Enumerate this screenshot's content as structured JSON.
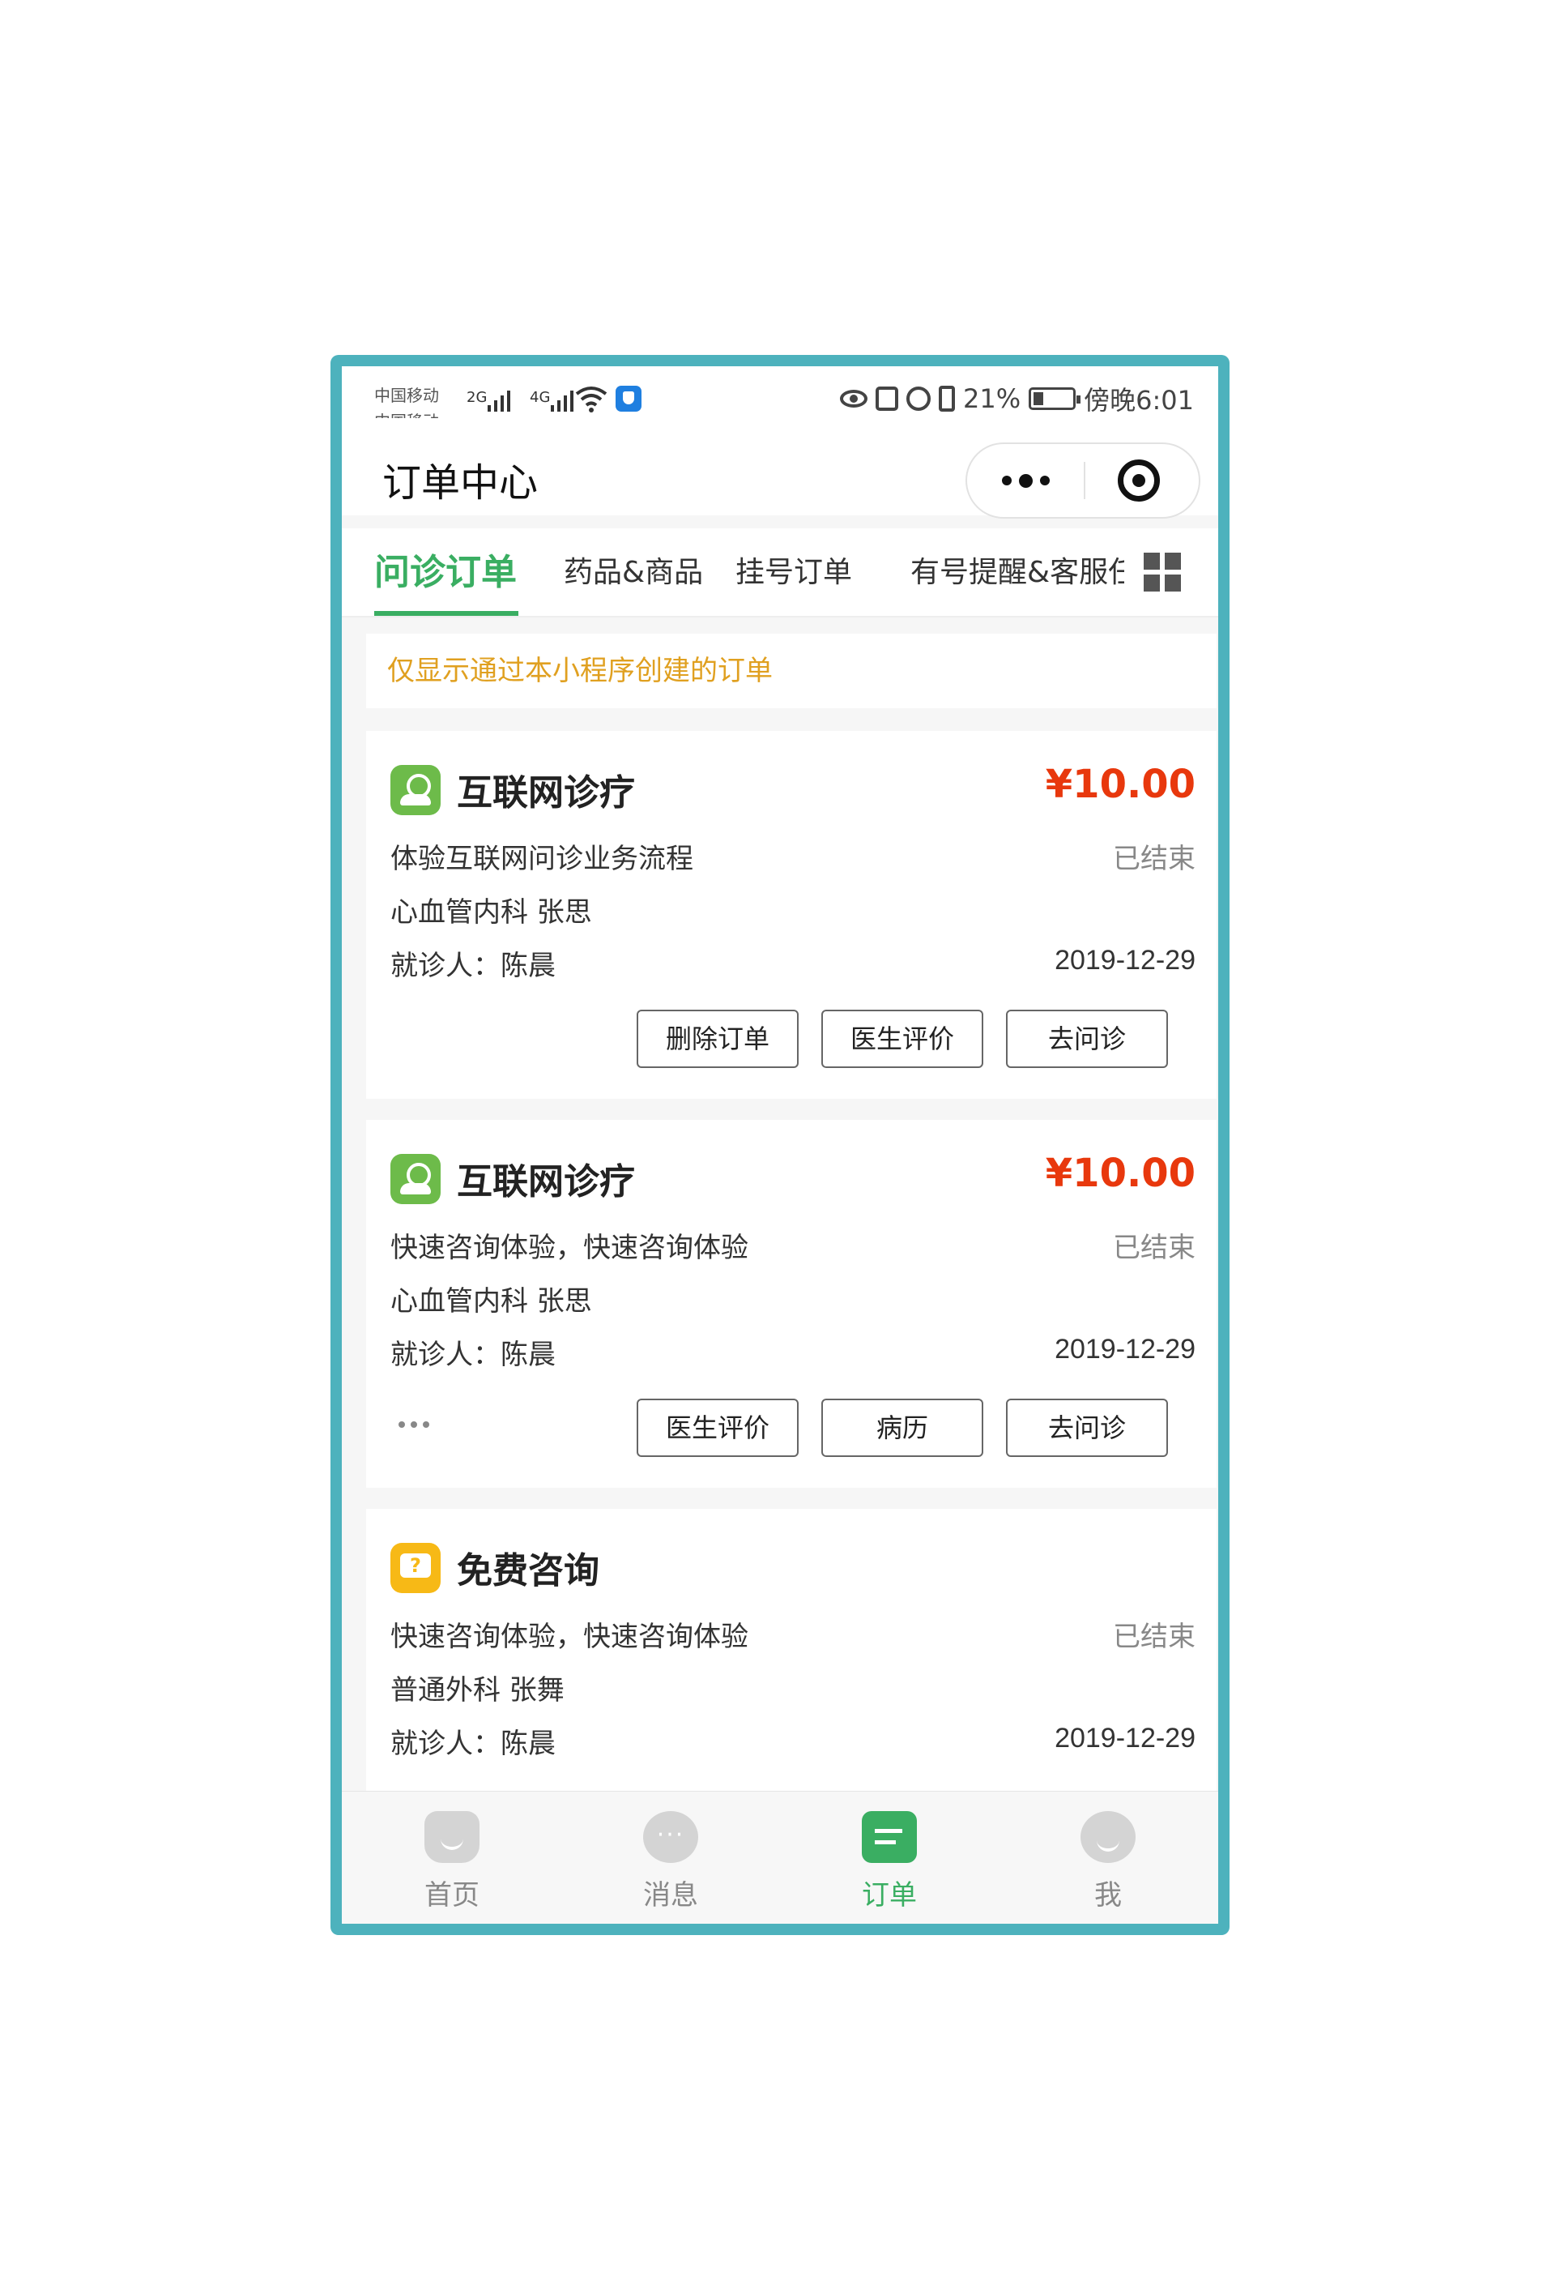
{
  "status_bar": {
    "carrier_1": "中国移动",
    "carrier_2": "中国移动",
    "signal_1": "2G",
    "signal_2": "4G",
    "battery": "21%",
    "time": "傍晚6:01"
  },
  "nav": {
    "title": "订单中心",
    "icons": [
      "more-icon",
      "target-icon"
    ]
  },
  "tabs": [
    {
      "label": "问诊订单",
      "active": true
    },
    {
      "label": "药品&商品",
      "active": false
    },
    {
      "label": "挂号订单",
      "active": false
    },
    {
      "label": "有号提醒&客服任务",
      "active": false
    }
  ],
  "notice": "仅显示通过本小程序创建的订单",
  "orders": [
    {
      "service": "互联网诊疗",
      "icon": "doctor-icon",
      "price": "¥10.00",
      "description": "体验互联网问诊业务流程",
      "status": "已结束",
      "doctor": "心血管内科 张思",
      "patient": "就诊人：陈晨",
      "date": "2019-12-29",
      "actions": [
        "删除订单",
        "医生评价",
        "去问诊"
      ]
    },
    {
      "service": "互联网诊疗",
      "icon": "doctor-icon",
      "price": "¥10.00",
      "description": "快速咨询体验，快速咨询体验",
      "status": "已结束",
      "doctor": "心血管内科 张思",
      "patient": "就诊人：陈晨",
      "date": "2019-12-29",
      "actions": [
        "医生评价",
        "病历",
        "去问诊"
      ]
    },
    {
      "service": "免费咨询",
      "icon": "question-chat-icon",
      "price": "",
      "description": "快速咨询体验，快速咨询体验",
      "status": "已结束",
      "doctor": "普通外科 张舞",
      "patient": "就诊人：陈晨",
      "date": "2019-12-29",
      "actions": []
    }
  ],
  "tabbar": [
    {
      "label": "首页",
      "icon": "home-icon"
    },
    {
      "label": "消息",
      "icon": "message-icon"
    },
    {
      "label": "订单",
      "icon": "order-icon",
      "active": true
    },
    {
      "label": "我",
      "icon": "profile-icon"
    }
  ],
  "colors": {
    "accent": "#3aae62",
    "price": "#e8380d",
    "notice": "#e0a020",
    "frame": "#4db2bd"
  }
}
